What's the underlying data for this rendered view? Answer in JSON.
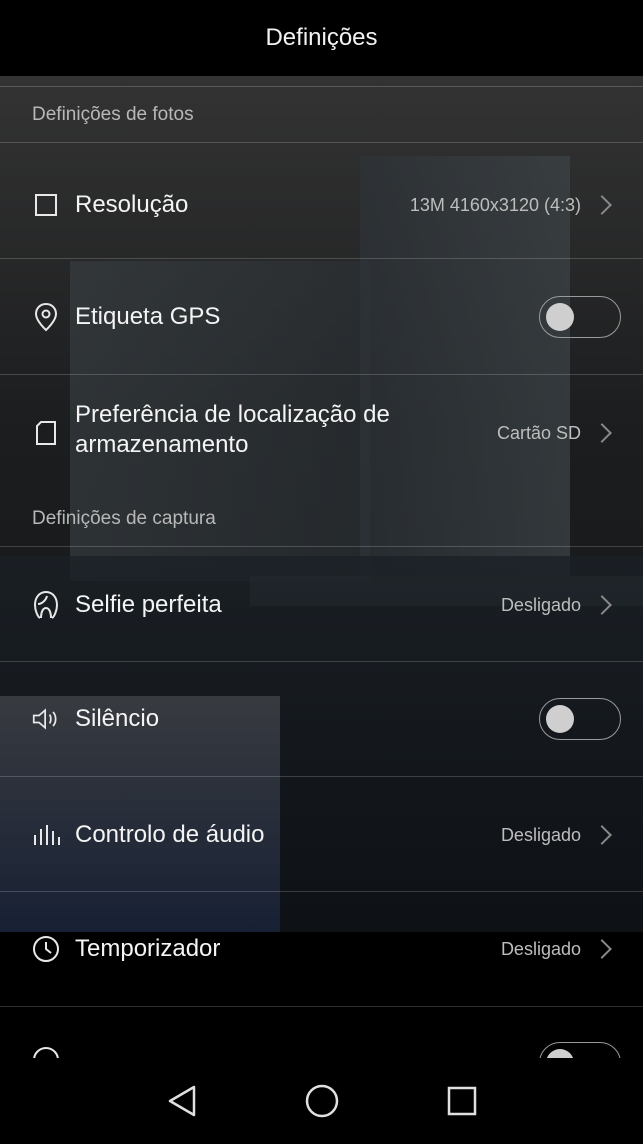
{
  "header": {
    "title": "Definições"
  },
  "sections": {
    "photos": "Definições de fotos",
    "capture": "Definições de captura"
  },
  "rows": {
    "resolution": {
      "label": "Resolução",
      "value": "13M 4160x3120 (4:3)",
      "icon": "square-icon"
    },
    "gps": {
      "label": "Etiqueta GPS",
      "toggle": false,
      "icon": "location-pin-icon"
    },
    "storage": {
      "label_line1": "Preferência de localização de",
      "label_line2": "armazenamento",
      "value": "Cartão SD",
      "icon": "sd-card-icon"
    },
    "selfie": {
      "label": "Selfie perfeita",
      "value": "Desligado",
      "icon": "face-icon"
    },
    "silence": {
      "label": "Silêncio",
      "toggle": false,
      "icon": "speaker-icon"
    },
    "audio": {
      "label": "Controlo de áudio",
      "value": "Desligado",
      "icon": "equalizer-icon"
    },
    "timer": {
      "label": "Temporizador",
      "value": "Desligado",
      "icon": "clock-icon"
    }
  },
  "navbar": {
    "back": "back-triangle-icon",
    "home": "home-circle-icon",
    "recents": "recents-square-icon"
  }
}
